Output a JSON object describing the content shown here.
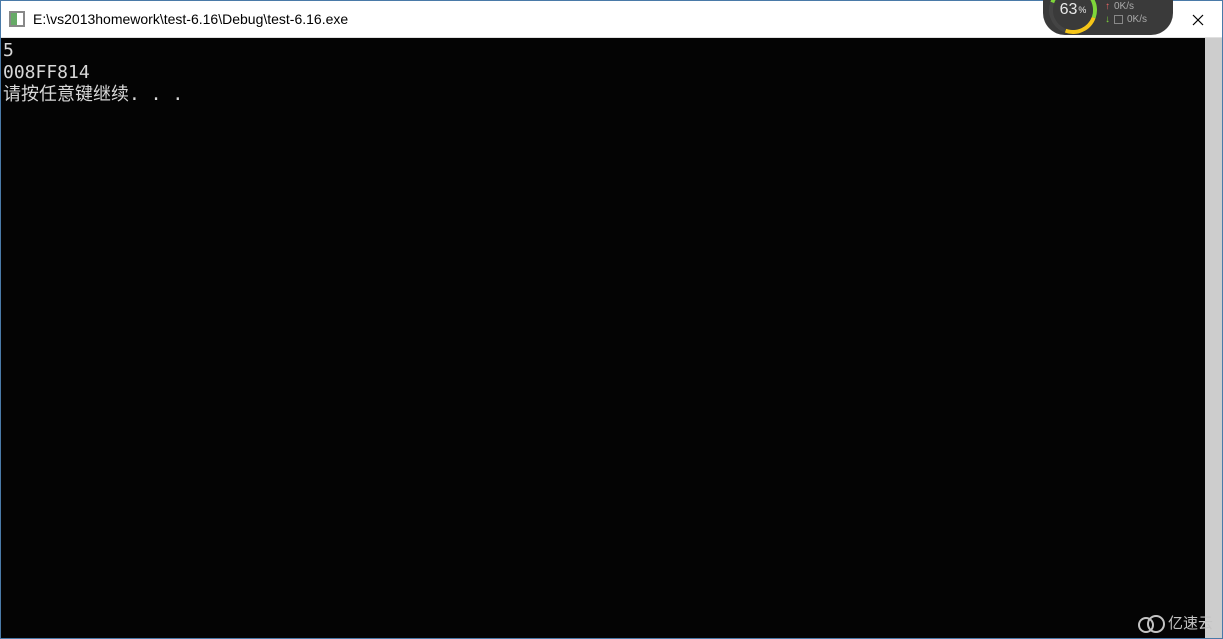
{
  "window": {
    "title": "E:\\vs2013homework\\test-6.16\\Debug\\test-6.16.exe"
  },
  "console": {
    "line1": "5",
    "line2": "008FF814",
    "line3": "请按任意键继续. . ."
  },
  "widget": {
    "percent": "63",
    "percent_sym": "%",
    "upload": "0K/s",
    "download": "0K/s"
  },
  "watermark": {
    "text": "亿速云"
  }
}
